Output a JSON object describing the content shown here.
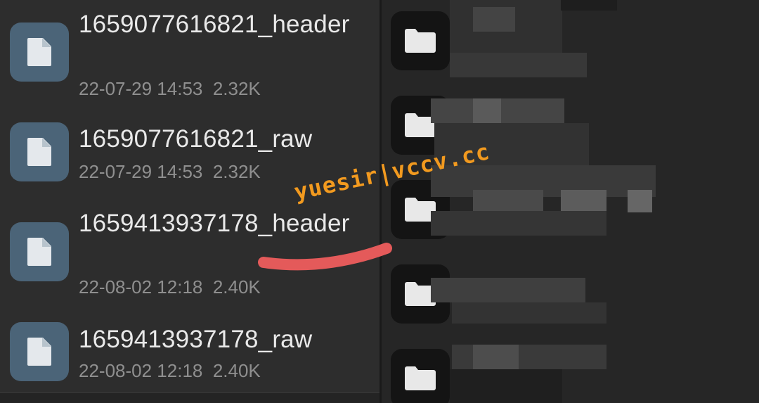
{
  "files": [
    {
      "name": "1659077616821_header",
      "date": "22-07-29 14:53",
      "size": "2.32K",
      "icon": "file-icon"
    },
    {
      "name": "1659077616821_raw",
      "date": "22-07-29 14:53",
      "size": "2.32K",
      "icon": "file-icon"
    },
    {
      "name": "1659413937178_header",
      "date": "22-08-02 12:18",
      "size": "2.40K",
      "icon": "file-icon"
    },
    {
      "name": "1659413937178_raw",
      "date": "22-08-02 12:18",
      "size": "2.40K",
      "icon": "file-icon"
    }
  ],
  "folders_icon": "folder-icon",
  "watermark": "yuesir|vccv.cc",
  "colors": {
    "file_icon_bg": "#4b6478",
    "left_bg": "#2d2d2d",
    "right_bg": "#262626",
    "watermark": "#f29a1f",
    "scribble": "#e45a5a"
  }
}
